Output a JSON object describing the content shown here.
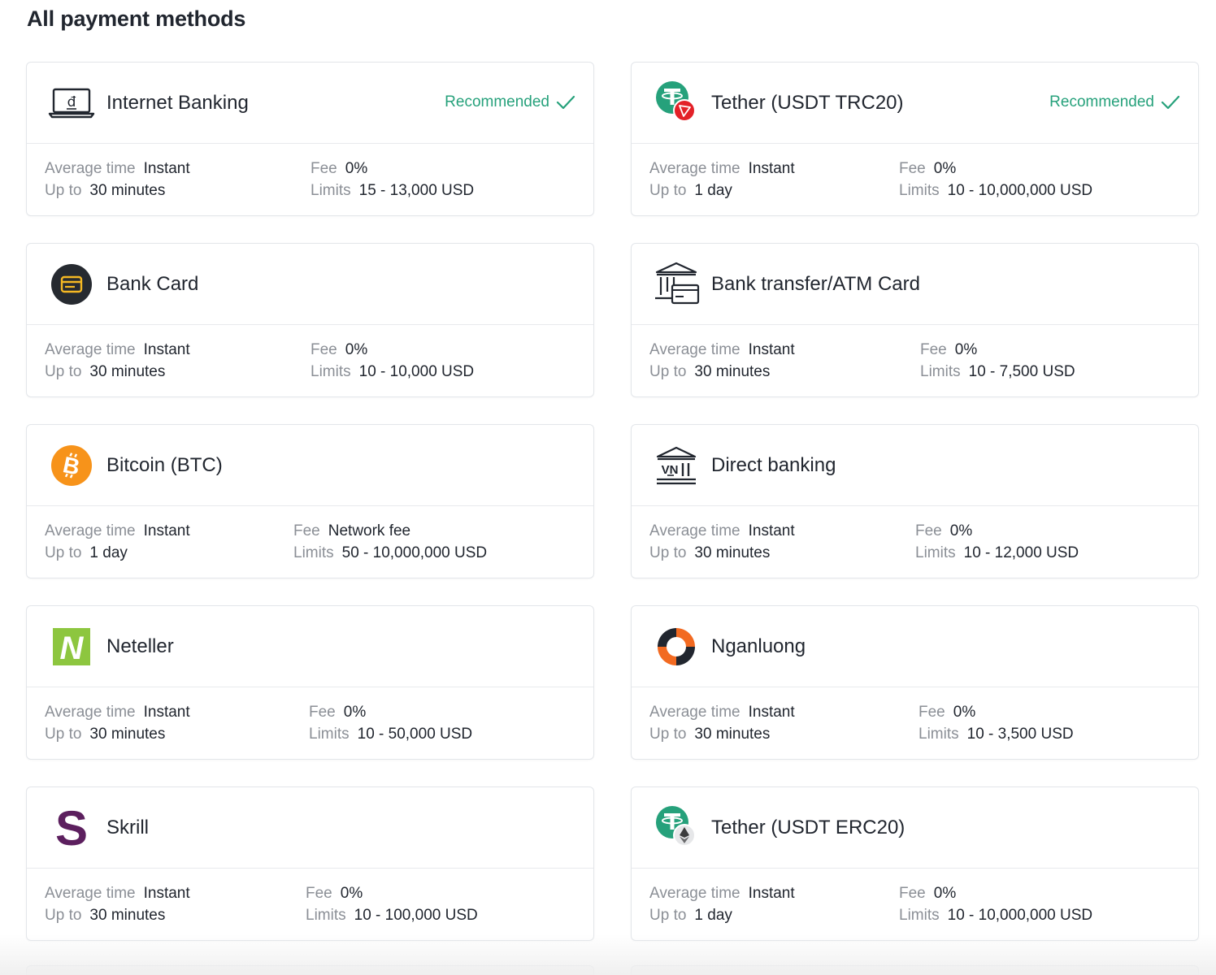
{
  "page": {
    "title": "All payment methods"
  },
  "labels": {
    "avg_time": "Average time",
    "up_to": "Up to",
    "fee": "Fee",
    "limits": "Limits",
    "recommended": "Recommended"
  },
  "methods": [
    {
      "name": "Internet Banking",
      "icon": "laptop-dong-icon",
      "recommended": true,
      "avg_time": "Instant",
      "up_to": "30 minutes",
      "fee": "0%",
      "limits": "15 - 13,000 USD"
    },
    {
      "name": "Tether (USDT TRC20)",
      "icon": "tether-trc20-icon",
      "recommended": true,
      "avg_time": "Instant",
      "up_to": "1 day",
      "fee": "0%",
      "limits": "10 - 10,000,000 USD"
    },
    {
      "name": "Bank Card",
      "icon": "bank-card-icon",
      "recommended": false,
      "avg_time": "Instant",
      "up_to": "30 minutes",
      "fee": "0%",
      "limits": "10 - 10,000 USD"
    },
    {
      "name": "Bank transfer/ATM Card",
      "icon": "bank-transfer-icon",
      "recommended": false,
      "avg_time": "Instant",
      "up_to": "30 minutes",
      "fee": "0%",
      "limits": "10 - 7,500 USD"
    },
    {
      "name": "Bitcoin (BTC)",
      "icon": "bitcoin-icon",
      "recommended": false,
      "avg_time": "Instant",
      "up_to": "1 day",
      "fee": "Network fee",
      "limits": "50 - 10,000,000 USD"
    },
    {
      "name": "Direct banking",
      "icon": "bank-building-vn-icon",
      "recommended": false,
      "avg_time": "Instant",
      "up_to": "30 minutes",
      "fee": "0%",
      "limits": "10 - 12,000 USD"
    },
    {
      "name": "Neteller",
      "icon": "neteller-icon",
      "recommended": false,
      "avg_time": "Instant",
      "up_to": "30 minutes",
      "fee": "0%",
      "limits": "10 - 50,000 USD"
    },
    {
      "name": "Nganluong",
      "icon": "nganluong-icon",
      "recommended": false,
      "avg_time": "Instant",
      "up_to": "30 minutes",
      "fee": "0%",
      "limits": "10 - 3,500 USD"
    },
    {
      "name": "Skrill",
      "icon": "skrill-icon",
      "recommended": false,
      "avg_time": "Instant",
      "up_to": "30 minutes",
      "fee": "0%",
      "limits": "10 - 100,000 USD"
    },
    {
      "name": "Tether (USDT ERC20)",
      "icon": "tether-erc20-icon",
      "recommended": false,
      "avg_time": "Instant",
      "up_to": "1 day",
      "fee": "0%",
      "limits": "10 - 10,000,000 USD"
    }
  ],
  "colors": {
    "accent_green": "#26a17b",
    "tether_green": "#26a17b",
    "tron_red": "#e32128",
    "bitcoin_orange": "#f7931a",
    "neteller_green": "#8dc63f",
    "skrill_purple": "#5c1f5e",
    "nganluong_orange": "#f26a21"
  }
}
